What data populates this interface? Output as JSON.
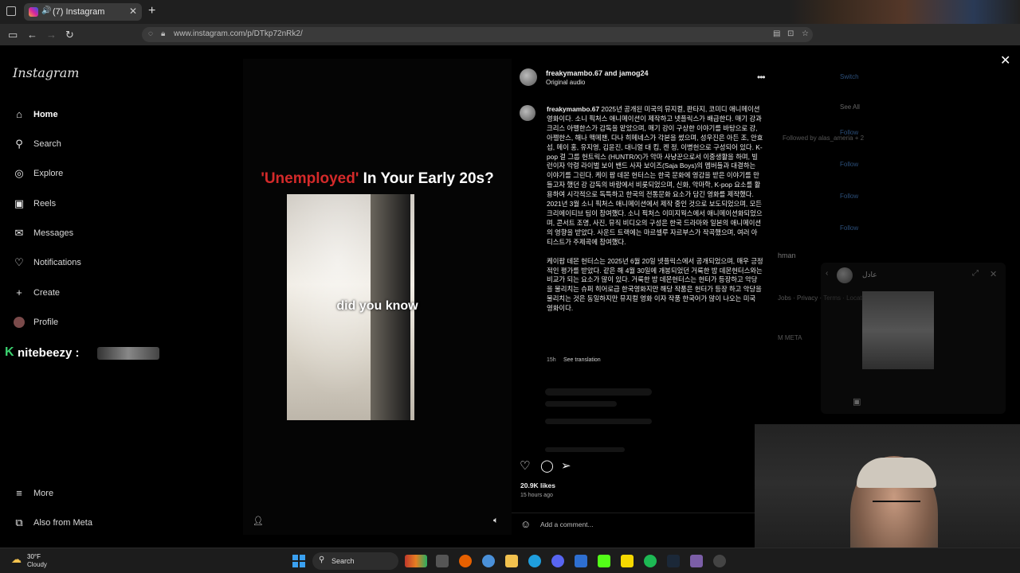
{
  "browser": {
    "tab_title": "(7) Instagram",
    "new_tab": "+",
    "url": "www.instagram.com/p/DTkp72nRk2/"
  },
  "sidebar": {
    "logo": "Instagram",
    "items": [
      {
        "label": "Home",
        "icon": "home-icon"
      },
      {
        "label": "Search",
        "icon": "search-icon"
      },
      {
        "label": "Explore",
        "icon": "compass-icon"
      },
      {
        "label": "Reels",
        "icon": "reels-icon"
      },
      {
        "label": "Messages",
        "icon": "messenger-icon"
      },
      {
        "label": "Notifications",
        "icon": "heart-icon"
      },
      {
        "label": "Create",
        "icon": "plus-icon"
      },
      {
        "label": "Profile",
        "icon": "avatar-icon"
      }
    ],
    "bottom": [
      {
        "label": "More",
        "icon": "menu-icon"
      },
      {
        "label": "Also from Meta",
        "icon": "meta-icon"
      }
    ]
  },
  "stream_chat": {
    "prefix": "K",
    "user": "nitebeezy :"
  },
  "background_feed": {
    "switch": "Switch",
    "see_all": "See All",
    "follow": "Follow",
    "followed_by": "Followed by alas_ameria + 2",
    "user_partial": "hman",
    "footer": "Jobs · Privacy · Terms · Locat",
    "meta": "M META"
  },
  "video": {
    "headline_red": "'Unemployed'",
    "headline_white": " In Your Early 20s?",
    "overlay": "did you know"
  },
  "post": {
    "owners": "freakymambo.67 and jamog24",
    "audio": "Original audio",
    "caption_user": "freakymambo.67",
    "caption_p1": " 2025년 공개된 미국의 뮤지컬, 판타지, 코미디 애니메이션 영화이다. 소니 픽처스 애니메이션이 제작하고 넷플릭스가 배급한다. 매기 강과 크리스 아펠한스가 감독을 맡았으며, 매기 강이 구상한 이야기를 바탕으로 강, 아펠한스, 해나 맥메챈, 다나 히메네스가 각본을 썼으며, 성우진은 아든 조, 안효섭, 메이 홍, 유지영, 김윤진, 대니얼 대 킴, 켄 정, 이병헌으로 구성되어 있다. K-pop 걸 그룹 헌트릭스 (HUNTR/X)가 악마 사냥꾼으로서 이중생활을 하며, 빌런이자 악령 라이벌 보이 밴드 사자 보이즈(Saja Boys)의 멤버들과 대결하는 이야기를 그린다. 케이 팝 데몬 헌터스는 한국 문화에 영감을 받은 이야기를 만들고자 했던 강 감독의 바람에서 비롯되었으며, 신화, 악마학, K-pop 요소를 활용하여 시각적으로 독특하고 한국의 전통문화 요소가 담긴 영화를 제작했다. 2021년 3월 소니 픽처스 애니메이션에서 제작 중인 것으로 보도되었으며, 모든 크리에이티브 팀이 참여했다. 소니 픽처스 이미지웍스에서 애니메이션화되었으며, 콘서트 조명, 사진, 뮤직 비디오의 구성은 한국 드라마와 일본의 애니메이션의 영향을 받았다. 사운드 트랙에는 마르셀루 자르부스가 작곡했으며, 여러 아티스트가 주제곡에 참여했다.",
    "caption_p2": "케이팝 데몬 헌터스는 2025년 6월 20일 넷플릭스에서 공개되었으며, 매우 긍정적인 평가를 받았다. 같은 해 4월 30일에 개봉되었던 거룩한 밤 데몬헌터스와는 비교가 되는 요소가 많이 있다. 거룩한 밤 데몬헌터스는 헌터가 등장하고 악당을 물리치는 슈퍼 히어로급 한국영화지만 해당 작품은 헌터가 등장 하고 악당을 물리치는 것은 동일하지만 뮤지컬 영화 이자 작품 한국어가 많이 나오는 미국 영화이다.",
    "time": "15h",
    "see_translation": "See translation",
    "likes": "20.9K likes",
    "ago": "15 hours ago",
    "comment_placeholder": "Add a comment..."
  },
  "dm_preview": {
    "name": "عادل"
  },
  "taskbar": {
    "temp": "30°F",
    "condition": "Cloudy",
    "search": "Search"
  },
  "colors": {
    "headline_red": "#d42a2a",
    "link_blue": "#2c4f7a",
    "chat_green": "#3bd16f",
    "start_blue": "#3aa0f0"
  }
}
